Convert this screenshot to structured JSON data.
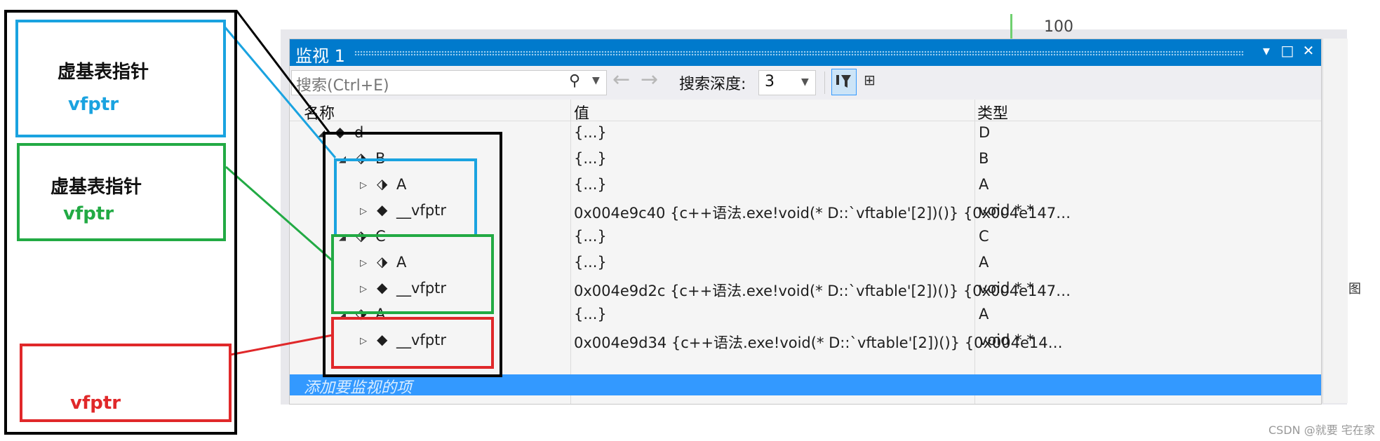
{
  "window": {
    "title": "监视 1",
    "buttons": [
      "▾",
      "□",
      "✕"
    ]
  },
  "toolbar": {
    "search_placeholder": "搜索(Ctrl+E)",
    "depth_label": "搜索深度:",
    "depth_value": "3"
  },
  "columns": {
    "name": "名称",
    "value": "值",
    "type": "类型"
  },
  "rows": [
    {
      "expander": "◢",
      "icon": "cube-icon",
      "name": "d",
      "value": "{...}",
      "type": "D"
    },
    {
      "expander": "◢",
      "icon": "base-class-icon",
      "name": "B",
      "value": "{...}",
      "type": "B"
    },
    {
      "expander": "▷",
      "icon": "base-class-icon",
      "name": "A",
      "value": "{...}",
      "type": "A"
    },
    {
      "expander": "▷",
      "icon": "cube-icon",
      "name": "__vfptr",
      "value": "0x004e9c40 {c++语法.exe!void(* D::`vftable'[2])()} {0x004e147…",
      "type": "void * *"
    },
    {
      "expander": "◢",
      "icon": "base-class-icon",
      "name": "C",
      "value": "{...}",
      "type": "C"
    },
    {
      "expander": "▷",
      "icon": "base-class-icon",
      "name": "A",
      "value": "{...}",
      "type": "A"
    },
    {
      "expander": "▷",
      "icon": "cube-icon",
      "name": "__vfptr",
      "value": "0x004e9d2c {c++语法.exe!void(* D::`vftable'[2])()} {0x004e147…",
      "type": "void * *"
    },
    {
      "expander": "◢",
      "icon": "base-class-icon",
      "name": "A",
      "value": "{...}",
      "type": "A"
    },
    {
      "expander": "▷",
      "icon": "cube-icon",
      "name": "__vfptr",
      "value": "0x004e9d34 {c++语法.exe!void(* D::`vftable'[2])()} {0x004e14…",
      "type": "void * *"
    }
  ],
  "add_watch_label": "添加要监视的项",
  "background": {
    "number": "100",
    "side_char": "图"
  },
  "annotations": {
    "blue": {
      "title": "虚基表指针",
      "label": "vfptr",
      "color": "#1aa3e0"
    },
    "green": {
      "title": "虚基表指针",
      "label": "vfptr",
      "color": "#22aa44"
    },
    "red": {
      "label": "vfptr",
      "color": "#e0282a"
    },
    "outline_color": "#000000"
  },
  "watermark": "CSDN @就要 宅在家"
}
